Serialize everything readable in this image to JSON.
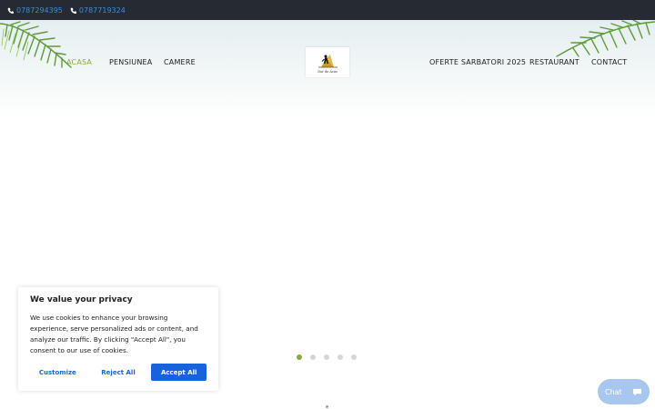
{
  "topbar": {
    "phones": [
      "0787294395",
      "0787719324"
    ],
    "phone_icon": "phone-icon"
  },
  "nav": {
    "left": [
      {
        "label": "ACASA",
        "active": true
      },
      {
        "label": "PENSIUNEA",
        "active": false
      },
      {
        "label": "CAMERE",
        "active": false
      }
    ],
    "right": [
      {
        "label": "OFERTE SARBATORI 2025",
        "active": false
      },
      {
        "label": "RESTAURANT",
        "active": false
      },
      {
        "label": "CONTACT",
        "active": false
      }
    ]
  },
  "logo": {
    "text": "Dor de Acas"
  },
  "cookie": {
    "title": "We value your privacy",
    "body": "We use cookies to enhance your browsing experience, serve personalized ads or content, and analyze our traffic. By clicking \"Accept All\", you consent to our use of cookies.",
    "customize": "Customize",
    "reject": "Reject All",
    "accept": "Accept All"
  },
  "slider": {
    "count": 5,
    "active_index": 0
  },
  "chat": {
    "label": "Chat",
    "icon": "chat-bubble-icon"
  },
  "colors": {
    "topbar_bg": "#252a33",
    "phone_link": "#3c8dd8",
    "nav_active": "#8bab3c",
    "primary_button": "#1863dc",
    "chat_bg": "#a8c7ee"
  }
}
